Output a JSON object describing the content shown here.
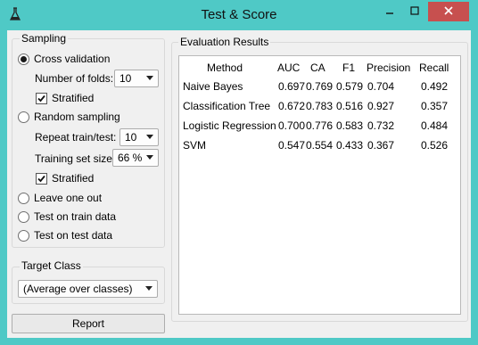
{
  "window": {
    "title": "Test & Score",
    "controls": {
      "minimize": "minimize",
      "maximize": "maximize",
      "close": "close"
    }
  },
  "sampling": {
    "title": "Sampling",
    "cross_validation": {
      "label": "Cross validation",
      "selected": true
    },
    "folds": {
      "label": "Number of folds:",
      "value": "10"
    },
    "stratified_cv": {
      "label": "Stratified",
      "checked": true
    },
    "random_sampling": {
      "label": "Random sampling",
      "selected": false
    },
    "repeat": {
      "label": "Repeat train/test:",
      "value": "10"
    },
    "train_size": {
      "label": "Training set size:",
      "value": "66 %"
    },
    "stratified_rs": {
      "label": "Stratified",
      "checked": true
    },
    "leave_one_out": {
      "label": "Leave one out",
      "selected": false
    },
    "train_data": {
      "label": "Test on train data",
      "selected": false
    },
    "test_data": {
      "label": "Test on test data",
      "selected": false
    }
  },
  "target_class": {
    "title": "Target Class",
    "value": "(Average over classes)"
  },
  "report_button": "Report",
  "evaluation": {
    "title": "Evaluation Results",
    "columns": [
      "Method",
      "AUC",
      "CA",
      "F1",
      "Precision",
      "Recall"
    ],
    "rows": [
      [
        "Naive Bayes",
        "0.697",
        "0.769",
        "0.579",
        "0.704",
        "0.492"
      ],
      [
        "Classification Tree",
        "0.672",
        "0.783",
        "0.516",
        "0.927",
        "0.357"
      ],
      [
        "Logistic Regression",
        "0.700",
        "0.776",
        "0.583",
        "0.732",
        "0.484"
      ],
      [
        "SVM",
        "0.547",
        "0.554",
        "0.433",
        "0.367",
        "0.526"
      ]
    ]
  },
  "colors": {
    "frame": "#4fc9c6",
    "close_button": "#c7504f",
    "panel": "#f0f0f0",
    "table_background": "#ffffff"
  }
}
